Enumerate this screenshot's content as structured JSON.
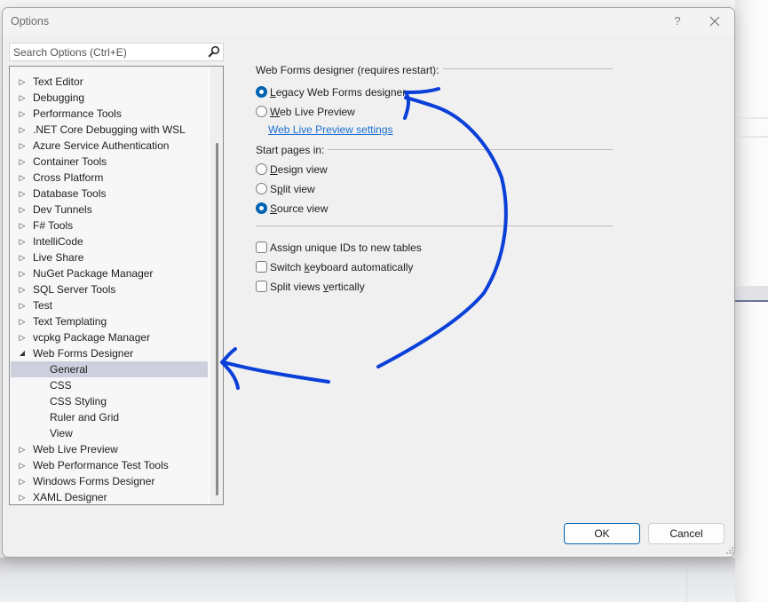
{
  "window": {
    "title": "Options",
    "help_label": "?",
    "close_icon": "close-icon"
  },
  "search": {
    "placeholder": "Search Options (Ctrl+E)",
    "value": "",
    "icon": "search-icon"
  },
  "tree": {
    "items": [
      {
        "label": "Text Editor",
        "expanded": false,
        "level": 0
      },
      {
        "label": "Debugging",
        "expanded": false,
        "level": 0
      },
      {
        "label": "Performance Tools",
        "expanded": false,
        "level": 0
      },
      {
        "label": ".NET Core Debugging with WSL",
        "expanded": false,
        "level": 0
      },
      {
        "label": "Azure Service Authentication",
        "expanded": false,
        "level": 0
      },
      {
        "label": "Container Tools",
        "expanded": false,
        "level": 0
      },
      {
        "label": "Cross Platform",
        "expanded": false,
        "level": 0
      },
      {
        "label": "Database Tools",
        "expanded": false,
        "level": 0
      },
      {
        "label": "Dev Tunnels",
        "expanded": false,
        "level": 0
      },
      {
        "label": "F# Tools",
        "expanded": false,
        "level": 0
      },
      {
        "label": "IntelliCode",
        "expanded": false,
        "level": 0
      },
      {
        "label": "Live Share",
        "expanded": false,
        "level": 0
      },
      {
        "label": "NuGet Package Manager",
        "expanded": false,
        "level": 0
      },
      {
        "label": "SQL Server Tools",
        "expanded": false,
        "level": 0
      },
      {
        "label": "Test",
        "expanded": false,
        "level": 0
      },
      {
        "label": "Text Templating",
        "expanded": false,
        "level": 0
      },
      {
        "label": "vcpkg Package Manager",
        "expanded": false,
        "level": 0
      },
      {
        "label": "Web Forms Designer",
        "expanded": true,
        "level": 0
      },
      {
        "label": "General",
        "level": 1,
        "selected": true
      },
      {
        "label": "CSS",
        "level": 1
      },
      {
        "label": "CSS Styling",
        "level": 1
      },
      {
        "label": "Ruler and Grid",
        "level": 1
      },
      {
        "label": "View",
        "level": 1
      },
      {
        "label": "Web Live Preview",
        "expanded": false,
        "level": 0
      },
      {
        "label": "Web Performance Test Tools",
        "expanded": false,
        "level": 0
      },
      {
        "label": "Windows Forms Designer",
        "expanded": false,
        "level": 0
      },
      {
        "label": "XAML Designer",
        "expanded": false,
        "level": 0
      }
    ],
    "collapsed_glyph": "▷",
    "expanded_glyph": "◢"
  },
  "panel": {
    "designer_group": {
      "label": "Web Forms designer (requires restart):",
      "options": [
        {
          "pre": "",
          "u": "L",
          "post": "egacy Web Forms designer",
          "checked": true
        },
        {
          "pre": "",
          "u": "W",
          "post": "eb Live Preview",
          "checked": false
        }
      ],
      "settings_link": "Web Live Preview settings"
    },
    "start_group": {
      "label": "Start pages in:",
      "options": [
        {
          "pre": "",
          "u": "D",
          "post": "esign view",
          "checked": false
        },
        {
          "pre": "S",
          "u": "p",
          "post": "lit view",
          "checked": false
        },
        {
          "pre": "",
          "u": "S",
          "post": "ource view",
          "checked": true
        }
      ]
    },
    "checkboxes": [
      {
        "pre": "Assi",
        "u": "g",
        "post": "n unique IDs to new tables",
        "checked": false
      },
      {
        "pre": "Switch ",
        "u": "k",
        "post": "eyboard automatically",
        "checked": false
      },
      {
        "pre": "Split views ",
        "u": "v",
        "post": "ertically",
        "checked": false
      }
    ]
  },
  "buttons": {
    "ok": "OK",
    "cancel": "Cancel"
  },
  "annotation": {
    "color": "#0a3fd8",
    "description": "hand-drawn arrows from Legacy Web Forms designer option to General tree item"
  }
}
